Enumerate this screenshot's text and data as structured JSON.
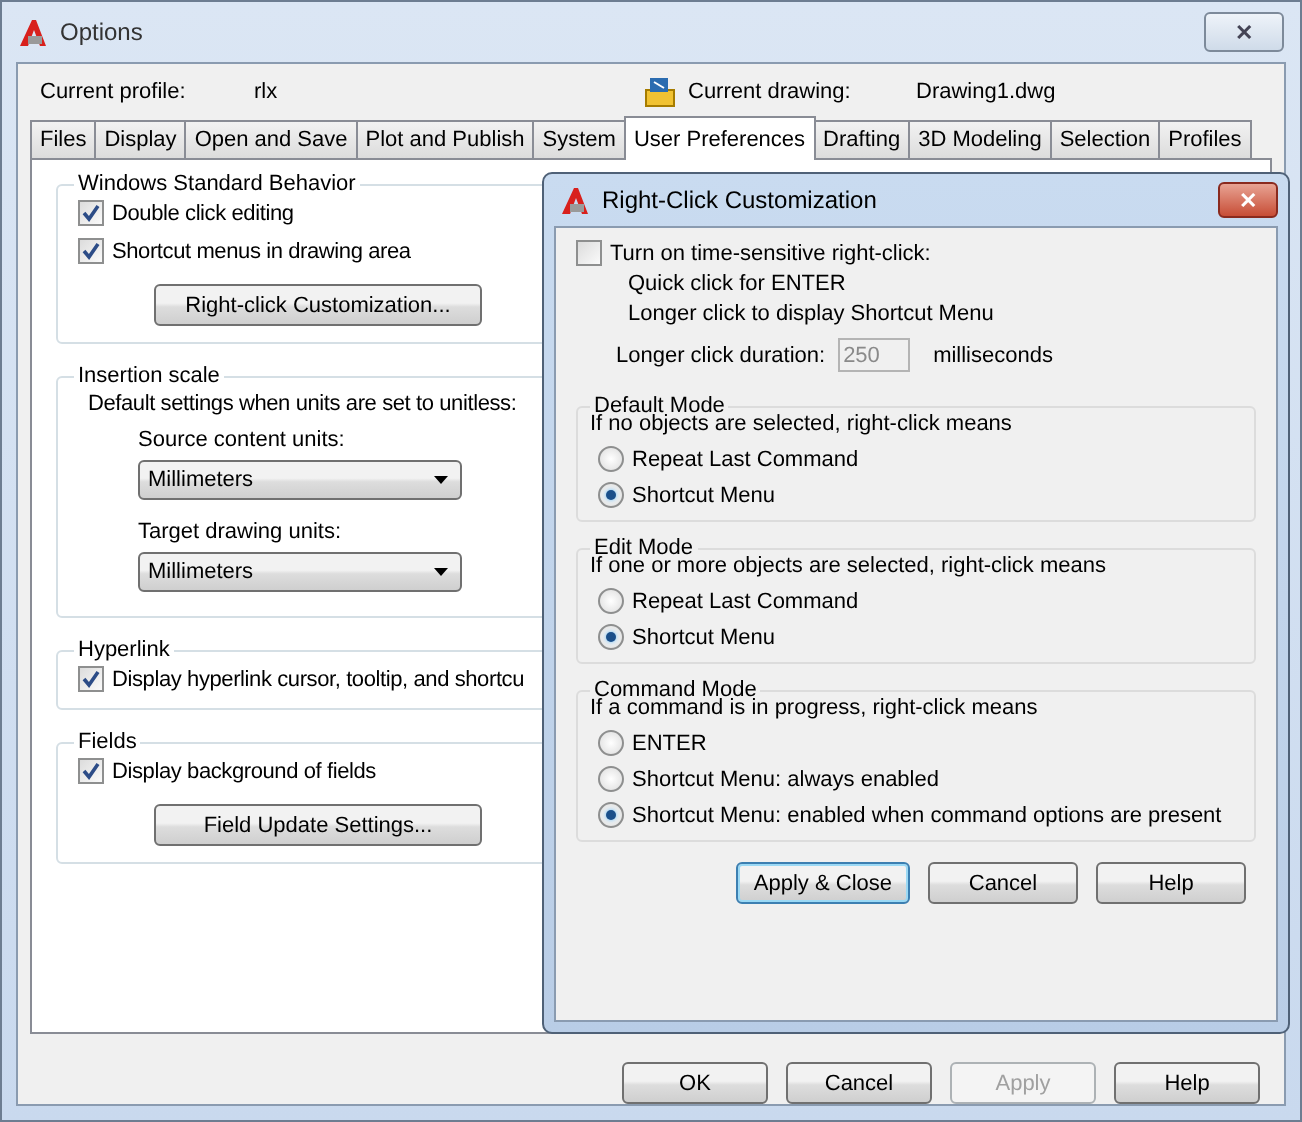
{
  "window": {
    "title": "Options",
    "close": "✕"
  },
  "profile": {
    "label": "Current profile:",
    "value": "rlx"
  },
  "drawing": {
    "label": "Current drawing:",
    "value": "Drawing1.dwg"
  },
  "tabs": [
    {
      "label": "Files",
      "selected": false
    },
    {
      "label": "Display",
      "selected": false
    },
    {
      "label": "Open and Save",
      "selected": false
    },
    {
      "label": "Plot and Publish",
      "selected": false
    },
    {
      "label": "System",
      "selected": false
    },
    {
      "label": "User Preferences",
      "selected": true
    },
    {
      "label": "Drafting",
      "selected": false
    },
    {
      "label": "3D Modeling",
      "selected": false
    },
    {
      "label": "Selection",
      "selected": false
    },
    {
      "label": "Profiles",
      "selected": false
    }
  ],
  "groups": [
    {
      "title": "Windows Standard Behavior",
      "items": [
        {
          "kind": "checkbox",
          "label": "Double click editing",
          "checked": true
        },
        {
          "kind": "checkbox",
          "label": "Shortcut menus in drawing area",
          "checked": true
        },
        {
          "kind": "button",
          "label": "Right-click Customization..."
        }
      ]
    },
    {
      "title": "Insertion scale",
      "items": [
        {
          "kind": "text",
          "label": "Default settings when units are set to unitless:"
        },
        {
          "kind": "select",
          "label": "Source content units:",
          "value": "Millimeters"
        },
        {
          "kind": "select",
          "label": "Target drawing units:",
          "value": "Millimeters"
        }
      ]
    },
    {
      "title": "Hyperlink",
      "items": [
        {
          "kind": "checkbox",
          "label": "Display hyperlink cursor, tooltip, and shortcu",
          "checked": true
        }
      ]
    },
    {
      "title": "Fields",
      "items": [
        {
          "kind": "checkbox",
          "label": "Display background of fields",
          "checked": true
        },
        {
          "kind": "button",
          "label": "Field Update Settings..."
        }
      ]
    }
  ],
  "buttons": [
    {
      "label": "OK",
      "disabled": false
    },
    {
      "label": "Cancel",
      "disabled": false
    },
    {
      "label": "Apply",
      "disabled": true
    },
    {
      "label": "Help",
      "disabled": false
    }
  ],
  "dialog": {
    "title": "Right-Click Customization",
    "close": "✕",
    "time_sensitive": {
      "label": "Turn on time-sensitive right-click:",
      "checked": false
    },
    "notes": [
      "Quick click for ENTER",
      "Longer click to display Shortcut Menu"
    ],
    "duration": {
      "label": "Longer click duration:",
      "value": "250",
      "unit": "milliseconds",
      "disabled": true
    },
    "modes": [
      {
        "title": "Default Mode",
        "hint": "If no objects are selected, right-click means",
        "options": [
          {
            "label": "Repeat Last Command",
            "selected": false
          },
          {
            "label": "Shortcut Menu",
            "selected": true
          }
        ]
      },
      {
        "title": "Edit Mode",
        "hint": "If one or more objects are selected, right-click means",
        "options": [
          {
            "label": "Repeat Last Command",
            "selected": false
          },
          {
            "label": "Shortcut Menu",
            "selected": true
          }
        ]
      },
      {
        "title": "Command Mode",
        "hint": "If a command is in progress, right-click means",
        "options": [
          {
            "label": "ENTER",
            "selected": false
          },
          {
            "label": "Shortcut Menu: always enabled",
            "selected": false
          },
          {
            "label": "Shortcut Menu: enabled when command options are present",
            "selected": true
          }
        ]
      }
    ],
    "buttons": [
      {
        "label": "Apply & Close",
        "default": true
      },
      {
        "label": "Cancel",
        "default": false
      },
      {
        "label": "Help",
        "default": false
      }
    ]
  }
}
